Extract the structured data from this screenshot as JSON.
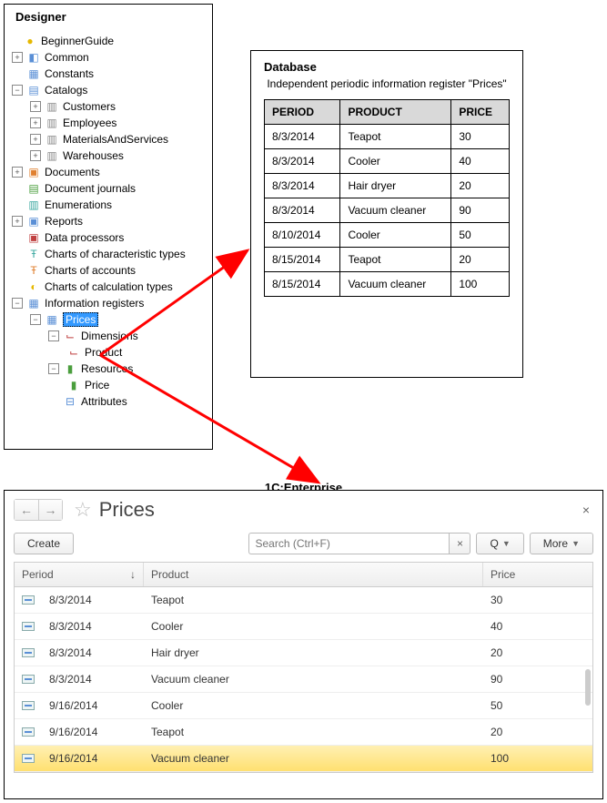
{
  "designer": {
    "title": "Designer",
    "root": "BeginnerGuide",
    "nodes": {
      "common": "Common",
      "constants": "Constants",
      "catalogs": "Catalogs",
      "customers": "Customers",
      "employees": "Employees",
      "materials": "MaterialsAndServices",
      "warehouses": "Warehouses",
      "documents": "Documents",
      "docjournals": "Document journals",
      "enums": "Enumerations",
      "reports": "Reports",
      "dataproc": "Data processors",
      "cctypes": "Charts of characteristic types",
      "caccounts": "Charts of accounts",
      "ccalctypes": "Charts of calculation types",
      "inforeg": "Information registers",
      "prices": "Prices",
      "dimensions": "Dimensions",
      "product_dim": "Product",
      "resources": "Resources",
      "price_res": "Price",
      "attributes": "Attributes"
    }
  },
  "database": {
    "title": "Database",
    "subtitle": "Independent periodic information register \"Prices\"",
    "columns": {
      "period": "PERIOD",
      "product": "PRODUCT",
      "price": "PRICE"
    },
    "rows": [
      {
        "period": "8/3/2014",
        "product": "Teapot",
        "price": "30"
      },
      {
        "period": "8/3/2014",
        "product": "Cooler",
        "price": "40"
      },
      {
        "period": "8/3/2014",
        "product": "Hair dryer",
        "price": "20"
      },
      {
        "period": "8/3/2014",
        "product": "Vacuum cleaner",
        "price": "90"
      },
      {
        "period": "8/10/2014",
        "product": "Cooler",
        "price": "50"
      },
      {
        "period": "8/15/2014",
        "product": "Teapot",
        "price": "20"
      },
      {
        "period": "8/15/2014",
        "product": "Vacuum cleaner",
        "price": "100"
      }
    ]
  },
  "section_label": "1C:Enterprise",
  "enterprise": {
    "title": "Prices",
    "create": "Create",
    "search_placeholder": "Search (Ctrl+F)",
    "more": "More",
    "columns": {
      "period": "Period",
      "product": "Product",
      "price": "Price"
    },
    "sort_indicator": "↓",
    "rows": [
      {
        "period": "8/3/2014",
        "product": "Teapot",
        "price": "30",
        "selected": false
      },
      {
        "period": "8/3/2014",
        "product": "Cooler",
        "price": "40",
        "selected": false
      },
      {
        "period": "8/3/2014",
        "product": "Hair dryer",
        "price": "20",
        "selected": false
      },
      {
        "period": "8/3/2014",
        "product": "Vacuum cleaner",
        "price": "90",
        "selected": false
      },
      {
        "period": "9/16/2014",
        "product": "Cooler",
        "price": "50",
        "selected": false
      },
      {
        "period": "9/16/2014",
        "product": "Teapot",
        "price": "20",
        "selected": false
      },
      {
        "period": "9/16/2014",
        "product": "Vacuum cleaner",
        "price": "100",
        "selected": true
      }
    ]
  }
}
